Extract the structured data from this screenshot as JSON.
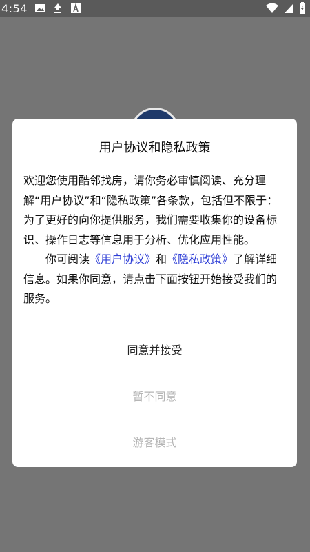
{
  "status_bar": {
    "time": "4:54",
    "icons": [
      "image-icon",
      "upload-icon",
      "a-box-icon"
    ],
    "right_icons": [
      "wifi-icon",
      "signal-icon",
      "battery-icon"
    ]
  },
  "dialog": {
    "title": "用户协议和隐私政策",
    "para1": "欢迎您使用酷邻找房，请你务必审慎阅读、充分理解“用户协议”和“隐私政策”各条款，包括但不限于：为了更好的向你提供服务，我们需要收集你的设备标识、操作日志等信息用于分析、优化应用性能。",
    "para2_prefix": "你可阅读",
    "link_user_agreement": "《用户协议》",
    "and_text": "和",
    "link_privacy_policy": "《隐私政策》",
    "para2_suffix": "了解详细信息。如果你同意，请点击下面按钮开始接受我们的服务。",
    "agree_label": "同意并接受",
    "disagree_label": "暂不同意",
    "guest_label": "游客模式"
  },
  "colors": {
    "link": "#2f3fd6",
    "disabled_text": "#b5b5b5",
    "overlay": "#757575"
  }
}
